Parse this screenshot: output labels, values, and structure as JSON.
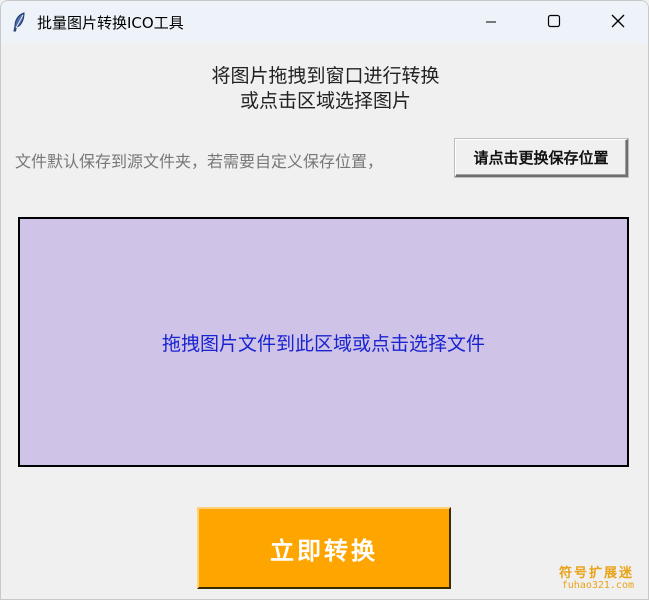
{
  "window": {
    "title": "批量图片转换ICO工具",
    "icon": "feather-icon",
    "controls": {
      "minimize": "minimize-icon",
      "maximize": "maximize-icon",
      "close": "close-icon"
    }
  },
  "instructions": {
    "line1": "将图片拖拽到窗口进行转换",
    "line2": "或点击区域选择图片"
  },
  "save": {
    "note": "文件默认保存到源文件夹，若需要自定义保存位置，",
    "button_label": "请点击更换保存位置"
  },
  "dropzone": {
    "label": "拖拽图片文件到此区域或点击选择文件",
    "background_color": "#cfc4e8",
    "text_color": "#1a23cf"
  },
  "convert": {
    "label": "立即转换",
    "color": "#ffa500"
  },
  "watermark": {
    "line1": "符号扩展迷",
    "line2": "fuhao321.com"
  }
}
